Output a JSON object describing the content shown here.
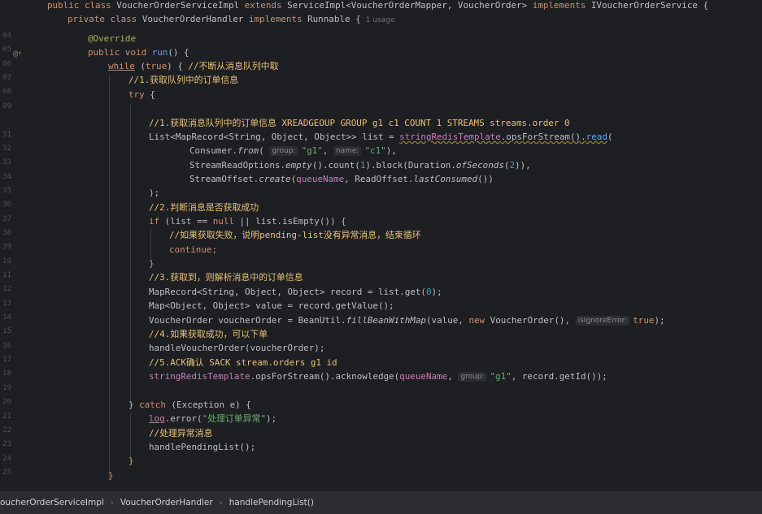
{
  "editor": {
    "line_numbers": [
      "",
      "",
      "",
      "04",
      "05",
      "06",
      "07",
      "08",
      "09",
      "",
      "31",
      "32",
      "33",
      "34",
      "35",
      "36",
      "37",
      "38",
      "39",
      "10",
      "11",
      "12",
      "13",
      "14",
      "15",
      "16",
      "17",
      "18",
      "19",
      "20",
      "21",
      "22",
      "23",
      "24",
      "25"
    ],
    "usage_hint": "1 usage",
    "hints": {
      "group": "group:",
      "name": "name:",
      "is_ignore_error": "isIgnoreError:"
    },
    "lines": {
      "l0_a": "public class ",
      "l0_b": "VoucherOrderServiceImpl ",
      "l0_c": "extends ",
      "l0_d": "ServiceImpl<VoucherOrderMapper, VoucherOrder> ",
      "l0_e": "implements ",
      "l0_f": "IVoucherOrderService {",
      "l1_a": "private class ",
      "l1_b": "VoucherOrderHandler ",
      "l1_c": "implements ",
      "l1_d": "Runnable {",
      "l3": "@Override",
      "l4_a": "public void ",
      "l4_b": "run",
      "l4_c": "() {",
      "l5_a": "while",
      "l5_b": " (",
      "l5_c": "true",
      "l5_d": ") { ",
      "l5_e": "//不断从消息队列中取",
      "l6": "//1.获取队列中的订单信息",
      "l7_a": "try",
      "l7_b": " {",
      "l9": "//1.获取消息队列中的订单信息 XREADGEOUP GROUP g1 c1 COUNT 1 STREAMS streams.order 0",
      "l10_a": "List<MapRecord<String, Object, Object>> list = ",
      "l10_b": "stringRedisTemplate",
      "l10_c": ".opsForStream().",
      "l10_d": "read",
      "l10_e": "(",
      "l11_a": "Consumer.",
      "l11_b": "from",
      "l11_c": "( ",
      "l11_d": "\"g1\"",
      "l11_e": ", ",
      "l11_f": "\"c1\"",
      "l11_g": "),",
      "l12_a": "StreamReadOptions.",
      "l12_b": "empty",
      "l12_c": "().count(",
      "l12_d": "1",
      "l12_e": ").block(Duration.",
      "l12_f": "ofSeconds",
      "l12_g": "(",
      "l12_h": "2",
      "l12_i": ")),",
      "l13_a": "StreamOffset.",
      "l13_b": "create",
      "l13_c": "(",
      "l13_d": "queueName",
      "l13_e": ", ReadOffset.",
      "l13_f": "lastConsumed",
      "l13_g": "())",
      "l14": ");",
      "l15": "//2.判断消息是否获取成功",
      "l16_a": "if",
      "l16_b": " (list == ",
      "l16_c": "null",
      "l16_d": " || list.isEmpty()) {",
      "l17": "//如果获取失败，说明pending-list没有异常消息，结束循环",
      "l18": "continue;",
      "l19": "}",
      "l20": "//3.获取到，则解析消息中的订单信息",
      "l21_a": "MapRecord<String, Object, Object> record = list.get(",
      "l21_b": "0",
      "l21_c": ");",
      "l22": "Map<Object, Object> value = record.getValue();",
      "l23_a": "VoucherOrder voucherOrder = BeanUtil.",
      "l23_b": "fillBeanWithMap",
      "l23_c": "(value, ",
      "l23_d": "new ",
      "l23_e": "VoucherOrder(), ",
      "l23_f": "true",
      "l23_g": ");",
      "l24": "//4.如果获取成功，可以下单",
      "l25": "handleVoucherOrder(voucherOrder);",
      "l26": "//5.ACK确认 SACK stream.orders g1 id",
      "l27_a": "stringRedisTemplate",
      "l27_b": ".opsForStream().acknowledge(",
      "l27_c": "queueName",
      "l27_d": ", ",
      "l27_e": "\"g1\"",
      "l27_f": ", record.getId());",
      "l29_a": "} ",
      "l29_b": "catch",
      "l29_c": " (Exception e) {",
      "l30_a": "log",
      "l30_b": ".error(",
      "l30_c": "\"处理订单异常\"",
      "l30_d": ");",
      "l31": "//处理异常消息",
      "l32": "handlePendingList();",
      "l33": "}",
      "l34": "}"
    }
  },
  "breadcrumb": [
    "oucherOrderServiceImpl",
    "VoucherOrderHandler",
    "handlePendingList()"
  ]
}
